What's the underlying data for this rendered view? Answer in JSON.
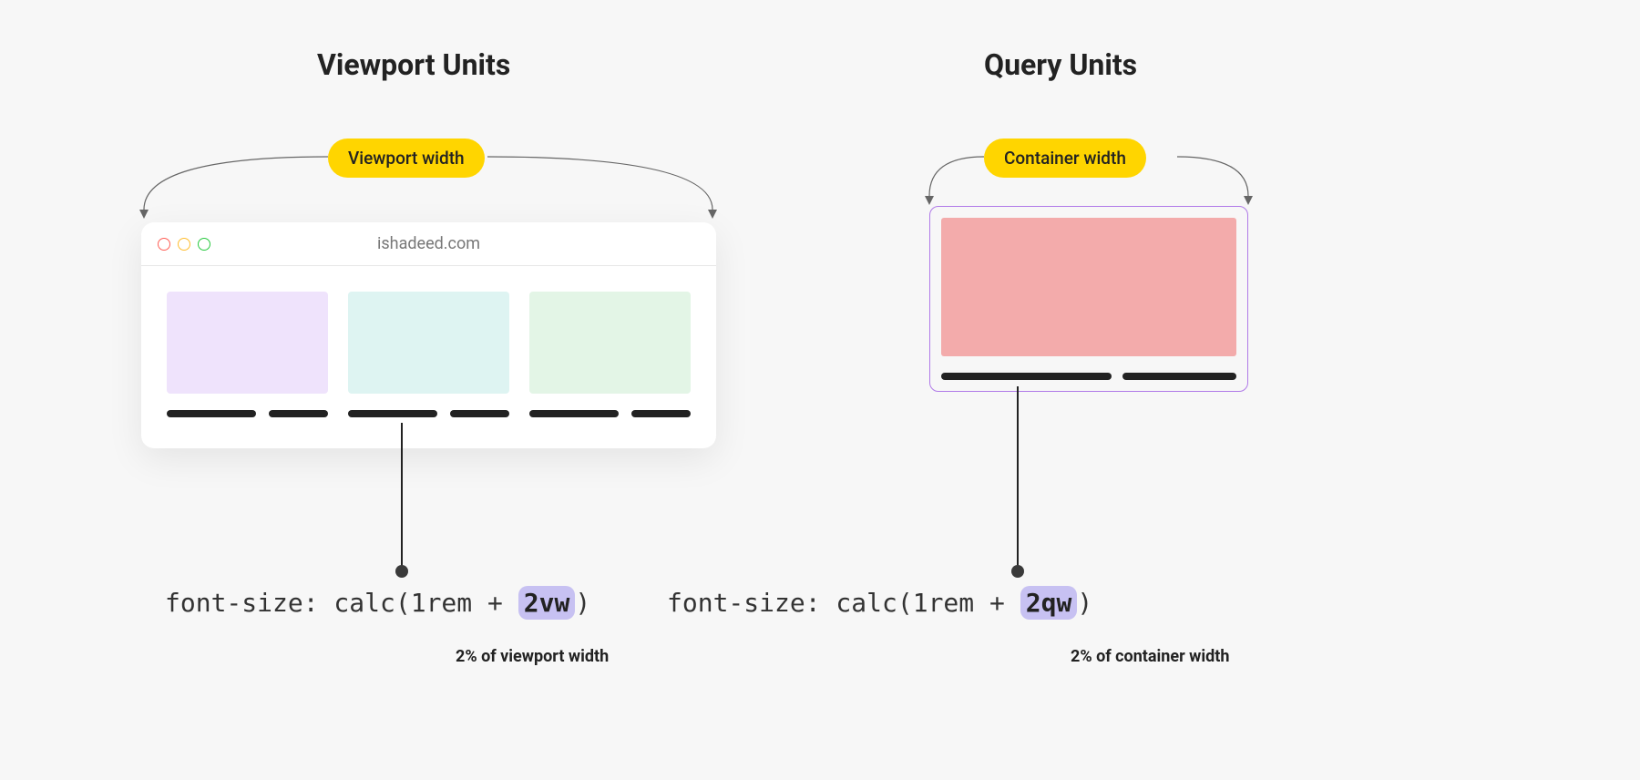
{
  "left": {
    "title": "Viewport Units",
    "pill": "Viewport width",
    "browser": {
      "url": "ishadeed.com"
    },
    "code": {
      "before": "font-size: calc(1rem + ",
      "highlight": "2vw",
      "after": ")"
    },
    "caption": "2% of viewport width"
  },
  "right": {
    "title": "Query Units",
    "pill": "Container width",
    "code": {
      "before": "font-size: calc(1rem + ",
      "highlight": "2qw",
      "after": ")"
    },
    "caption": "2% of container width"
  }
}
